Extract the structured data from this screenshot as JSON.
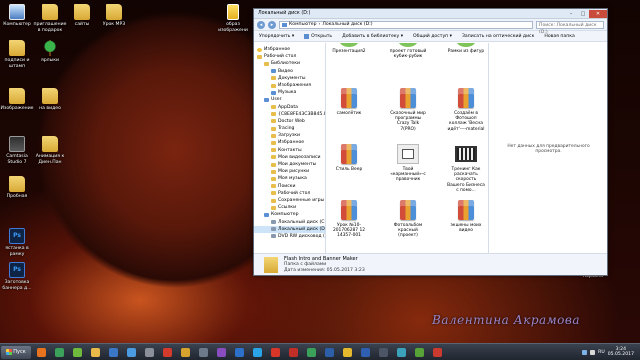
{
  "desktop": {
    "icons": [
      {
        "label": "Компьютер",
        "icon": "computer-icon"
      },
      {
        "label": "приглашение в подарок",
        "icon": "folder-icon"
      },
      {
        "label": "сайты",
        "icon": "folder-icon"
      },
      {
        "label": "Урок МР3",
        "icon": "folder-icon"
      },
      {
        "label": "образ изображени",
        "icon": "document-icon"
      },
      {
        "label": "подписи и штамп",
        "icon": "folder-icon"
      },
      {
        "label": "ярлыки",
        "icon": "tree-icon"
      },
      {
        "label": "Изображение",
        "icon": "folder-icon"
      },
      {
        "label": "на видео",
        "icon": "folder-icon"
      },
      {
        "label": "Camtasia Studio 7",
        "icon": "camtasia-icon"
      },
      {
        "label": "Анимация к Диен.Пан",
        "icon": "folder-icon"
      },
      {
        "label": "Пробная",
        "icon": "folder-icon"
      },
      {
        "label": "ястанка в рамку",
        "icon": "photoshop-icon"
      },
      {
        "label": "Заготовка баннера д...",
        "icon": "photoshop-icon"
      }
    ],
    "recycle_bin_label": "Корзина",
    "signature": "Валентина Акрамова"
  },
  "window": {
    "title": "Локальный диск (D:)",
    "address": [
      "Компьютер",
      "Локальный диск (D:)"
    ],
    "search_placeholder": "Поиск: Локальный диск (D:)",
    "toolbar": [
      "Упорядочить ▾",
      "Открыть",
      "Добавить в библиотеку ▾",
      "Общий доступ ▾",
      "Записать на оптический диск",
      "Новая папка"
    ],
    "nav_items": [
      {
        "label": "Избранное",
        "level": 0,
        "icon": "star"
      },
      {
        "label": "Рабочий стол",
        "level": 0,
        "icon": "folder"
      },
      {
        "label": "Библиотеки",
        "level": 1,
        "icon": "folder"
      },
      {
        "label": "Видео",
        "level": 2,
        "icon": "blue"
      },
      {
        "label": "Документы",
        "level": 2,
        "icon": "folder"
      },
      {
        "label": "Изображения",
        "level": 2,
        "icon": "folder"
      },
      {
        "label": "Музыка",
        "level": 2,
        "icon": "blue"
      },
      {
        "label": "User",
        "level": 1,
        "icon": "blue"
      },
      {
        "label": "AppData",
        "level": 2,
        "icon": "folder"
      },
      {
        "label": "{C8E8FE43C3B845.IDEFI",
        "level": 2,
        "icon": "folder"
      },
      {
        "label": "Doctor Web",
        "level": 2,
        "icon": "folder"
      },
      {
        "label": "Tracing",
        "level": 2,
        "icon": "folder"
      },
      {
        "label": "Загрузки",
        "level": 2,
        "icon": "folder"
      },
      {
        "label": "Избранное",
        "level": 2,
        "icon": "folder"
      },
      {
        "label": "Контакты",
        "level": 2,
        "icon": "folder"
      },
      {
        "label": "Мои видеозаписи",
        "level": 2,
        "icon": "folder"
      },
      {
        "label": "Мои документы",
        "level": 2,
        "icon": "folder"
      },
      {
        "label": "Мои рисунки",
        "level": 2,
        "icon": "folder"
      },
      {
        "label": "Моя музыка",
        "level": 2,
        "icon": "folder"
      },
      {
        "label": "Поиски",
        "level": 2,
        "icon": "folder"
      },
      {
        "label": "Рабочий стол",
        "level": 2,
        "icon": "folder"
      },
      {
        "label": "Сохраненные игры",
        "level": 2,
        "icon": "folder"
      },
      {
        "label": "Ссылки",
        "level": 2,
        "icon": "folder"
      },
      {
        "label": "Компьютер",
        "level": 1,
        "icon": "blue"
      },
      {
        "label": "Локальный диск (C:)",
        "level": 2,
        "icon": "drive"
      },
      {
        "label": "Локальный диск (D:)",
        "level": 2,
        "icon": "drive",
        "selected": true
      },
      {
        "label": "DVD RW дисковод (E:)",
        "level": 2,
        "icon": "drive"
      }
    ],
    "files": [
      {
        "label": "Презентация2",
        "kind": "cutoff"
      },
      {
        "label": "проект готовый кубик-рубик",
        "kind": "cutoff"
      },
      {
        "label": "Рамки из фигур",
        "kind": "cutoff"
      },
      {
        "label": "самолётик",
        "kind": "rar"
      },
      {
        "label": "Сказочный мир программы Crazy Talk 7(PRO)",
        "kind": "rar"
      },
      {
        "label": "Создаём в Фотошоп коллаж 'Весна идёт'----material",
        "kind": "rar"
      },
      {
        "label": "Стиль Веер",
        "kind": "rar"
      },
      {
        "label": "Твой «карманный»-с правочник",
        "kind": "doc"
      },
      {
        "label": "Тренинг Как раскачать скорость Вашего Бизнеса с помо...",
        "kind": "video"
      },
      {
        "label": "Урок №10-201706287 12 14357-001",
        "kind": "rar"
      },
      {
        "label": "Фотоальбом красный (проект)",
        "kind": "rar"
      },
      {
        "label": "экшены моих видео",
        "kind": "rar"
      }
    ],
    "preview_text": "Нет данных для предварительного просмотра.",
    "details": {
      "name": "Flash Intro and Banner Maker",
      "type": "Папка с файлами",
      "modified": "Дата изменения: 05.05.2017 3:23"
    }
  },
  "taskbar": {
    "start_label": "Пуск",
    "apps": [
      {
        "name": "firefox",
        "color": "#e8731f"
      },
      {
        "name": "chrome",
        "color": "#3ba15a"
      },
      {
        "name": "utorrent",
        "color": "#6fba3c"
      },
      {
        "name": "explorer",
        "color": "#e9b94a"
      },
      {
        "name": "media",
        "color": "#3a77c7"
      },
      {
        "name": "store",
        "color": "#4a9be0"
      },
      {
        "name": "settings",
        "color": "#8a8f99"
      },
      {
        "name": "opera",
        "color": "#d33b2c"
      },
      {
        "name": "at-app",
        "color": "#d8a22e"
      },
      {
        "name": "window",
        "color": "#6d7a8c"
      },
      {
        "name": "onenote",
        "color": "#8a4dbf"
      },
      {
        "name": "photoshop",
        "color": "#2c70c9"
      },
      {
        "name": "skype",
        "color": "#2aa4e6"
      },
      {
        "name": "yandex",
        "color": "#d9362a"
      },
      {
        "name": "tool-red",
        "color": "#c22f28"
      },
      {
        "name": "chrome-2",
        "color": "#3ba15a"
      },
      {
        "name": "word",
        "color": "#2d5ea8"
      },
      {
        "name": "yandex-browser",
        "color": "#e6b82d"
      },
      {
        "name": "app-blue",
        "color": "#2f5fb3"
      },
      {
        "name": "app-dark",
        "color": "#4c5566"
      },
      {
        "name": "vpn",
        "color": "#3ca1ba"
      },
      {
        "name": "camtasia",
        "color": "#57a338"
      },
      {
        "name": "recorder",
        "color": "#cb3a2e"
      }
    ],
    "tray_lang": "RU",
    "clock_time": "3:24",
    "clock_date": "05.05.2017"
  }
}
